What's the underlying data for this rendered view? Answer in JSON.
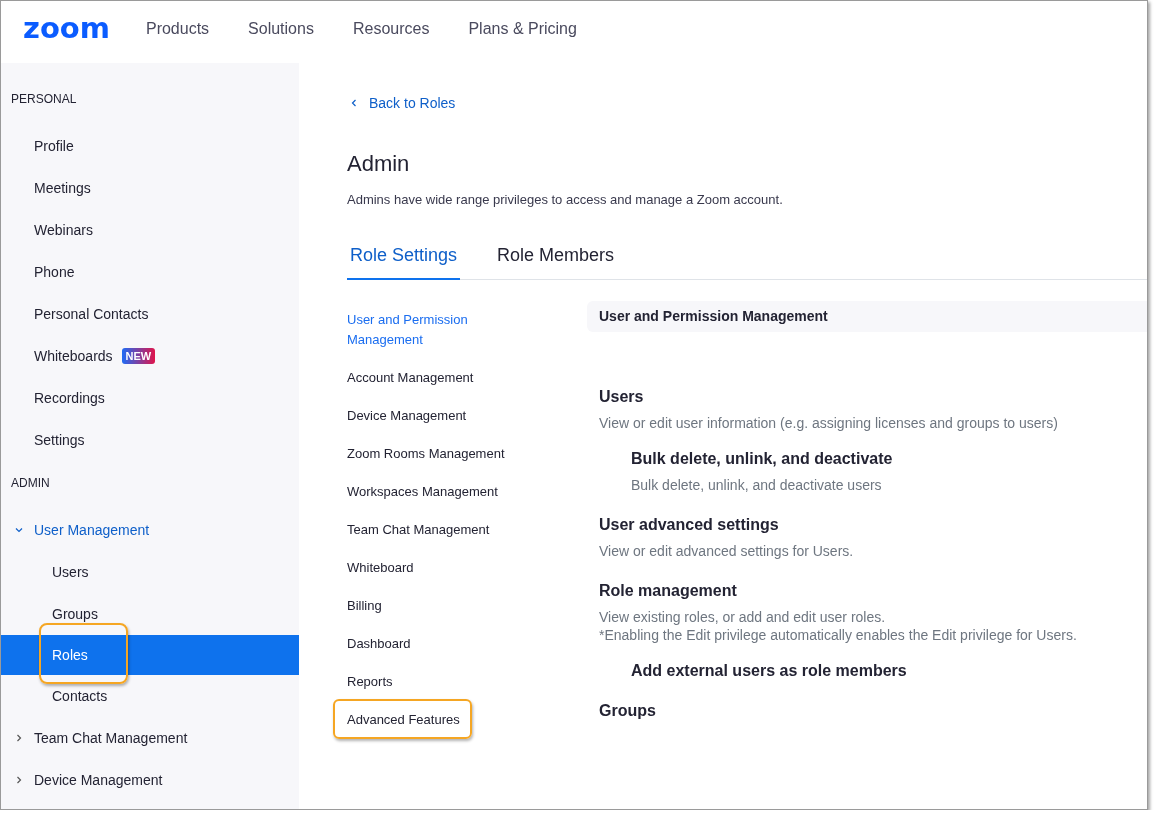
{
  "header": {
    "logo": "zoom",
    "links": [
      "Products",
      "Solutions",
      "Resources",
      "Plans & Pricing"
    ]
  },
  "sidebar": {
    "sections": [
      {
        "heading": "PERSONAL",
        "items": [
          {
            "label": "Profile",
            "selected": false
          },
          {
            "label": "Meetings",
            "selected": false
          },
          {
            "label": "Webinars",
            "selected": false
          },
          {
            "label": "Phone",
            "selected": false
          },
          {
            "label": "Personal Contacts",
            "selected": false
          },
          {
            "label": "Whiteboards",
            "selected": false,
            "badge": "NEW"
          },
          {
            "label": "Recordings",
            "selected": false
          },
          {
            "label": "Settings",
            "selected": false
          }
        ]
      },
      {
        "heading": "ADMIN",
        "items": [
          {
            "label": "User Management",
            "selected": false,
            "expanded": true,
            "children": [
              {
                "label": "Users",
                "selected": false,
                "callout": false
              },
              {
                "label": "Groups",
                "selected": false,
                "callout": false
              },
              {
                "label": "Roles",
                "selected": true,
                "callout": true
              },
              {
                "label": "Contacts",
                "selected": false,
                "callout": false
              }
            ]
          },
          {
            "label": "Team Chat Management",
            "selected": false,
            "expanded": false
          },
          {
            "label": "Device Management",
            "selected": false,
            "expanded": false
          }
        ]
      }
    ]
  },
  "main": {
    "back_link": "Back to Roles",
    "title": "Admin",
    "description": "Admins have wide range privileges to access and manage a Zoom account.",
    "tabs": [
      {
        "label": "Role Settings",
        "selected": true
      },
      {
        "label": "Role Members",
        "selected": false
      }
    ],
    "categories": [
      {
        "label": "User and Permission Management",
        "selected": true,
        "callout": false
      },
      {
        "label": "Account Management",
        "selected": false,
        "callout": false
      },
      {
        "label": "Device Management",
        "selected": false,
        "callout": false
      },
      {
        "label": "Zoom Rooms Management",
        "selected": false,
        "callout": false
      },
      {
        "label": "Workspaces Management",
        "selected": false,
        "callout": false
      },
      {
        "label": "Team Chat Management",
        "selected": false,
        "callout": false
      },
      {
        "label": "Whiteboard",
        "selected": false,
        "callout": false
      },
      {
        "label": "Billing",
        "selected": false,
        "callout": false
      },
      {
        "label": "Dashboard",
        "selected": false,
        "callout": false
      },
      {
        "label": "Reports",
        "selected": false,
        "callout": false
      },
      {
        "label": "Advanced Features",
        "selected": false,
        "callout": true
      }
    ],
    "section_header": "User and Permission Management",
    "settings": [
      {
        "kind": "group",
        "title": "Users",
        "description": [
          "View or edit user information (e.g. assigning licenses and groups to users)"
        ]
      },
      {
        "kind": "item",
        "title": "Bulk delete, unlink, and deactivate",
        "description": [
          "Bulk delete, unlink, and deactivate users"
        ]
      },
      {
        "kind": "group",
        "title": "User advanced settings",
        "description": [
          "View or edit advanced settings for Users."
        ]
      },
      {
        "kind": "group",
        "title": "Role management",
        "description": [
          "View existing roles, or add and edit user roles.",
          "*Enabling the Edit privilege automatically enables the Edit privilege for Users."
        ]
      },
      {
        "kind": "item",
        "title": "Add external users as role members"
      },
      {
        "kind": "group",
        "title": "Groups"
      }
    ]
  }
}
